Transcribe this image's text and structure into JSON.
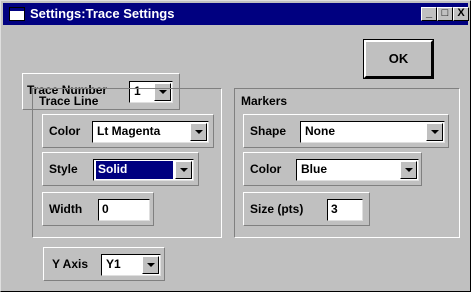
{
  "window": {
    "title": "Settings:Trace Settings",
    "controls": [
      "_",
      "□",
      "X"
    ]
  },
  "trace_number": {
    "label": "Trace Number",
    "value": "1"
  },
  "ok_button": {
    "label": "OK"
  },
  "trace_line": {
    "heading": "Trace Line",
    "color": {
      "label": "Color",
      "value": "Lt Magenta"
    },
    "style": {
      "label": "Style",
      "value": "Solid"
    },
    "width": {
      "label": "Width",
      "value": "0"
    }
  },
  "markers": {
    "heading": "Markers",
    "shape": {
      "label": "Shape",
      "value": "None"
    },
    "color": {
      "label": "Color",
      "value": "Blue"
    },
    "size": {
      "label": "Size (pts)",
      "value": "3"
    }
  },
  "y_axis": {
    "label": "Y Axis",
    "value": "Y1"
  },
  "colors": {
    "titlebar": "#000080",
    "face": "#c0c0c0",
    "selection": "#000080"
  }
}
